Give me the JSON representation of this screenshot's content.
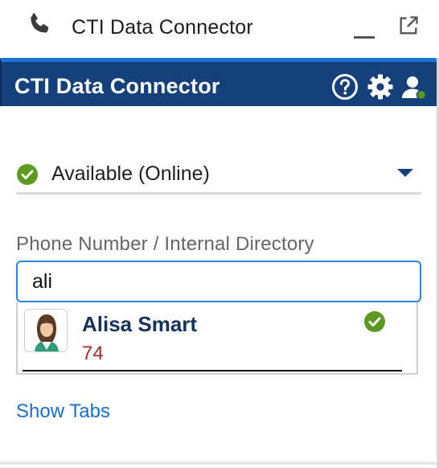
{
  "utility_bar": {
    "title": "CTI Data Connector",
    "icons": {
      "phone": "phone-icon",
      "minimize": "minimize-icon",
      "popout": "popout-icon"
    }
  },
  "panel": {
    "title": "CTI Data Connector",
    "header_color": "#16407b",
    "icons": {
      "help": "help-icon",
      "settings": "gear-icon",
      "user": "user-status-icon"
    }
  },
  "status": {
    "value": "Available (Online)",
    "indicator_color": "#5b9a1e"
  },
  "search": {
    "label": "Phone Number / Internal Directory",
    "value": "ali"
  },
  "results": [
    {
      "name": "Alisa Smart",
      "extension": "74",
      "status_color": "#5b9a1e",
      "status_icon": "check-circle-icon"
    }
  ],
  "links": {
    "show_tabs": "Show Tabs"
  },
  "colors": {
    "accent": "#1a74d6",
    "link": "#1a6fd1",
    "extension": "#a52a2a",
    "online": "#5b9a1e"
  }
}
